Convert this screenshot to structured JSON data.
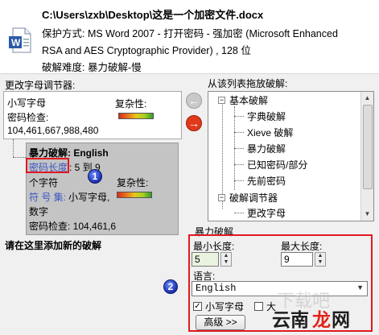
{
  "header": {
    "file_path": "C:\\Users\\zxb\\Desktop\\这是一个加密文件.docx",
    "protection_line1": "保护方式: MS Word 2007 - 打开密码 - 强加密 (Microsoft Enhanced",
    "protection_line2": "RSA and AES Cryptographic Provider) , 128 位",
    "difficulty": "破解难度: 暴力破解-慢"
  },
  "left": {
    "group_title": "更改字母调节器:",
    "lowercase": {
      "title": "小写字母",
      "complexity_label": "复杂性:",
      "check_label": "密码检查:",
      "check_value": "104,461,667,988,480"
    },
    "attack": {
      "title": "暴力破解: English",
      "length_label": "密码长度",
      "length_value": ": 5 到 9",
      "badge1": "1",
      "chars_prefix": "个字符",
      "complexity_label": "复杂性:",
      "charset_label": "符 号 集:",
      "charset_value": "小写字母,",
      "digits": "数字",
      "check_value": "密码检查: 104,461,6"
    },
    "add_new": "请在这里添加新的破解"
  },
  "right": {
    "list_title": "从该列表拖放破解:",
    "tree": [
      {
        "label": "基本破解",
        "expander": "−"
      },
      {
        "label": "字典破解"
      },
      {
        "label": "Xieve 破解"
      },
      {
        "label": "暴力破解"
      },
      {
        "label": "已知密码/部分"
      },
      {
        "label": "先前密码"
      },
      {
        "label": "破解调节器",
        "expander": "−"
      },
      {
        "label": "更改字母"
      }
    ],
    "brute_force": {
      "group_label": "暴力破解",
      "min_label": "最小长度:",
      "min_value": "5",
      "max_label": "最大长度:",
      "max_value": "9",
      "language_label": "语言:",
      "language_value": "English",
      "lowercase_label": "小写字母",
      "lowercase_checked": "✓",
      "uppercase_label": "大",
      "advanced_button": "高级 >>",
      "badge2": "2"
    }
  },
  "colors": {
    "highlight_red": "#e0191f",
    "link_blue": "#3b57c4",
    "badge_blue": "#1b2fb0"
  }
}
